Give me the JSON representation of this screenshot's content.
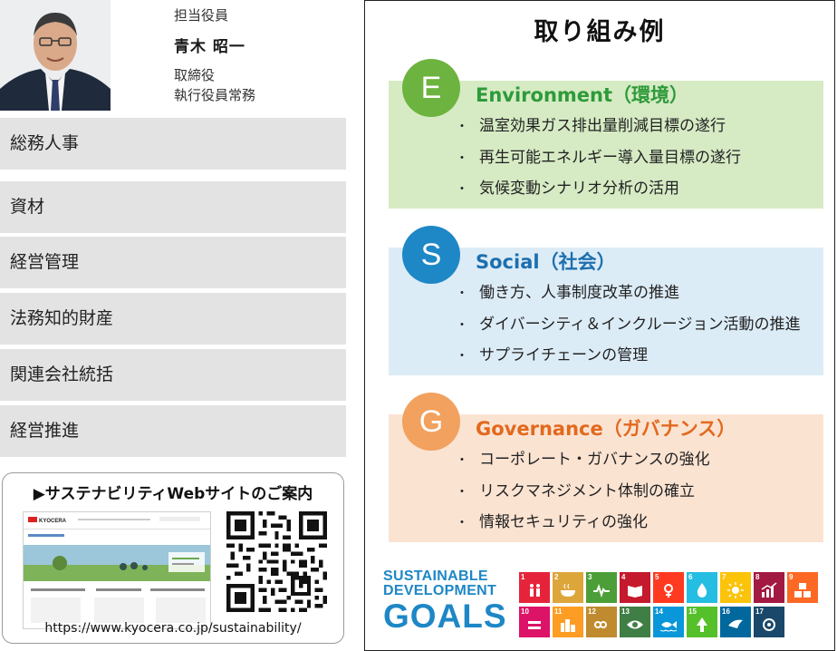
{
  "executive": {
    "role_label": "担当役員",
    "name": "青木 昭一",
    "titles": [
      "取締役",
      "執行役員常務"
    ]
  },
  "departments": [
    "総務人事",
    "資材",
    "経営管理",
    "法務知的財産",
    "関連会社統括",
    "経営推進"
  ],
  "website": {
    "heading": "▶サステナビリティWebサイトのご案内",
    "url": "https://www.kyocera.co.jp/sustainability/",
    "thumbnail_brand": "KYOCERA"
  },
  "panel": {
    "title": "取り組み例",
    "esg": [
      {
        "letter": "E",
        "heading": "Environment（環境）",
        "color": "#6db33f",
        "heading_color": "#2e9a3a",
        "bg": "#d6ebc4",
        "items": [
          "温室効果ガス排出量削減目標の遂行",
          "再生可能エネルギー導入量目標の遂行",
          "気候変動シナリオ分析の活用"
        ]
      },
      {
        "letter": "S",
        "heading": "Social（社会）",
        "color": "#1e87c6",
        "heading_color": "#1e6fae",
        "bg": "#dcecf7",
        "items": [
          "働き方、人事制度改革の推進",
          "ダイバーシティ＆インクルージョン活動の推進",
          "サプライチェーンの管理"
        ]
      },
      {
        "letter": "G",
        "heading": "Governance（ガバナンス）",
        "color": "#f2a15e",
        "heading_color": "#e2691e",
        "bg": "#fbe3d2",
        "items": [
          "コーポレート・ガバナンスの強化",
          "リスクマネジメント体制の確立",
          "情報セキュリティの強化"
        ]
      }
    ],
    "bullet": "・"
  },
  "sdgs": {
    "logo_lines": [
      "SUSTAINABLE",
      "DEVELOPMENT",
      "GOALS"
    ],
    "tiles": [
      {
        "n": "1",
        "color": "#e5243b",
        "icon": "people-icon"
      },
      {
        "n": "2",
        "color": "#dda63a",
        "icon": "bowl-icon"
      },
      {
        "n": "3",
        "color": "#4c9f38",
        "icon": "heartbeat-icon"
      },
      {
        "n": "4",
        "color": "#c5192d",
        "icon": "book-icon"
      },
      {
        "n": "5",
        "color": "#ff3a21",
        "icon": "gender-icon"
      },
      {
        "n": "6",
        "color": "#26bde2",
        "icon": "water-drop-icon"
      },
      {
        "n": "7",
        "color": "#fcc30b",
        "icon": "sun-icon"
      },
      {
        "n": "8",
        "color": "#a21942",
        "icon": "growth-chart-icon"
      },
      {
        "n": "9",
        "color": "#fd6925",
        "icon": "cubes-icon"
      },
      {
        "n": "10",
        "color": "#dd1367",
        "icon": "equal-icon"
      },
      {
        "n": "11",
        "color": "#fd9d24",
        "icon": "city-icon"
      },
      {
        "n": "12",
        "color": "#bf8b2e",
        "icon": "infinity-icon"
      },
      {
        "n": "13",
        "color": "#3f7e44",
        "icon": "eye-globe-icon"
      },
      {
        "n": "14",
        "color": "#0a97d9",
        "icon": "fish-icon"
      },
      {
        "n": "15",
        "color": "#56c02b",
        "icon": "tree-icon"
      },
      {
        "n": "16",
        "color": "#00689d",
        "icon": "dove-icon"
      },
      {
        "n": "17",
        "color": "#19486a",
        "icon": "rings-icon"
      }
    ]
  }
}
